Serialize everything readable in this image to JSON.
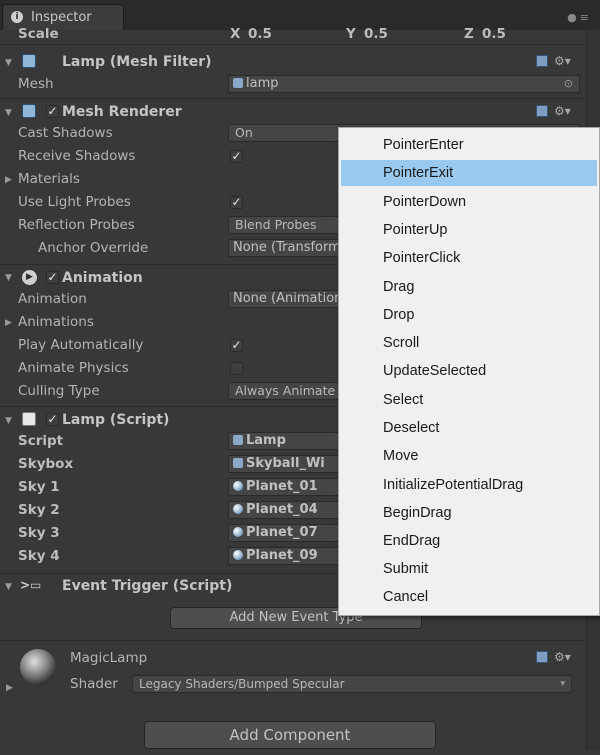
{
  "tab": {
    "label": "Inspector"
  },
  "transform": {
    "scale_label": "Scale",
    "x_label": "X",
    "x_value": "0.5",
    "y_label": "Y",
    "y_value": "0.5",
    "z_label": "Z",
    "z_value": "0.5"
  },
  "mesh_filter": {
    "title": "Lamp (Mesh Filter)",
    "mesh_label": "Mesh",
    "mesh_value": "lamp"
  },
  "mesh_renderer": {
    "title": "Mesh Renderer",
    "cast_shadows_label": "Cast Shadows",
    "cast_shadows_value": "On",
    "receive_shadows_label": "Receive Shadows",
    "materials_label": "Materials",
    "light_probes_label": "Use Light Probes",
    "reflection_probes_label": "Reflection Probes",
    "reflection_probes_value": "Blend Probes",
    "anchor_override_label": "Anchor Override",
    "anchor_override_value": "None (Transform)"
  },
  "animation": {
    "title": "Animation",
    "animation_label": "Animation",
    "animation_value": "None (Animation Clip)",
    "animations_label": "Animations",
    "play_auto_label": "Play Automatically",
    "animate_physics_label": "Animate Physics",
    "culling_label": "Culling Type",
    "culling_value": "Always Animate"
  },
  "lamp_script": {
    "title": "Lamp (Script)",
    "script_label": "Script",
    "script_value": "Lamp",
    "skybox_label": "Skybox",
    "skybox_value": "Skyball_Wi",
    "sky1_label": "Sky 1",
    "sky1_value": "Planet_01",
    "sky2_label": "Sky 2",
    "sky2_value": "Planet_04",
    "sky3_label": "Sky 3",
    "sky3_value": "Planet_07",
    "sky4_label": "Sky 4",
    "sky4_value": "Planet_09"
  },
  "event_trigger": {
    "title": "Event Trigger (Script)",
    "add_button": "Add New Event Type"
  },
  "material": {
    "name": "MagicLamp",
    "shader_label": "Shader",
    "shader_value": "Legacy Shaders/Bumped Specular"
  },
  "add_component_button": "Add Component",
  "event_menu": {
    "items": [
      "PointerEnter",
      "PointerExit",
      "PointerDown",
      "PointerUp",
      "PointerClick",
      "Drag",
      "Drop",
      "Scroll",
      "UpdateSelected",
      "Select",
      "Deselect",
      "Move",
      "InitializePotentialDrag",
      "BeginDrag",
      "EndDrag",
      "Submit",
      "Cancel"
    ],
    "selected": "PointerExit"
  }
}
